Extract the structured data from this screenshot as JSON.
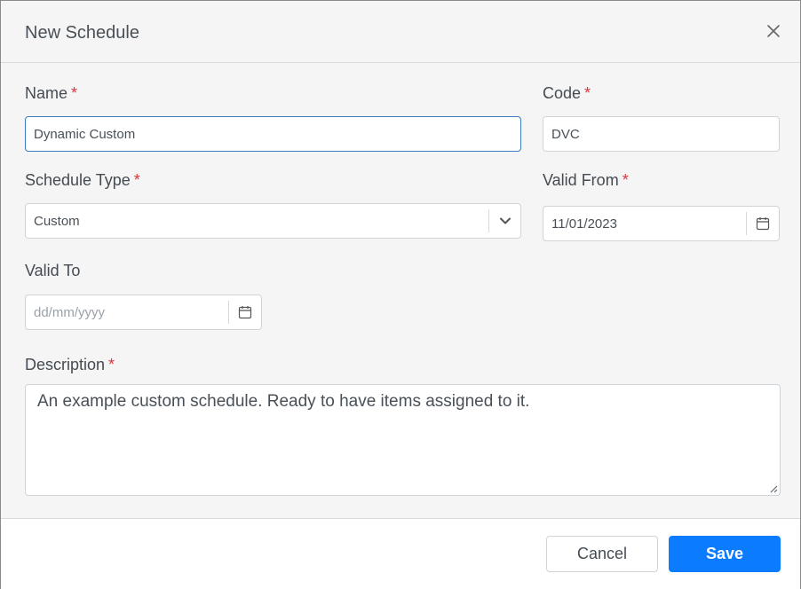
{
  "dialog": {
    "title": "New Schedule",
    "close_icon": "close-icon"
  },
  "form": {
    "name": {
      "label": "Name",
      "required": "*",
      "value": "Dynamic Custom"
    },
    "code": {
      "label": "Code",
      "required": "*",
      "value": "DVC"
    },
    "schedule_type": {
      "label": "Schedule Type",
      "required": "*",
      "value": "Custom",
      "icon": "chevron-down-icon"
    },
    "valid_from": {
      "label": "Valid From",
      "required": "*",
      "value": "11/01/2023",
      "icon": "calendar-icon"
    },
    "valid_to": {
      "label": "Valid To",
      "placeholder": "dd/mm/yyyy",
      "icon": "calendar-icon"
    },
    "description": {
      "label": "Description",
      "required": "*",
      "value": "An example custom schedule. Ready to have items assigned to it."
    }
  },
  "footer": {
    "cancel_label": "Cancel",
    "save_label": "Save"
  },
  "colors": {
    "primary": "#0b7cff",
    "required": "#d9363e",
    "focus_border": "#3b7bbf"
  }
}
